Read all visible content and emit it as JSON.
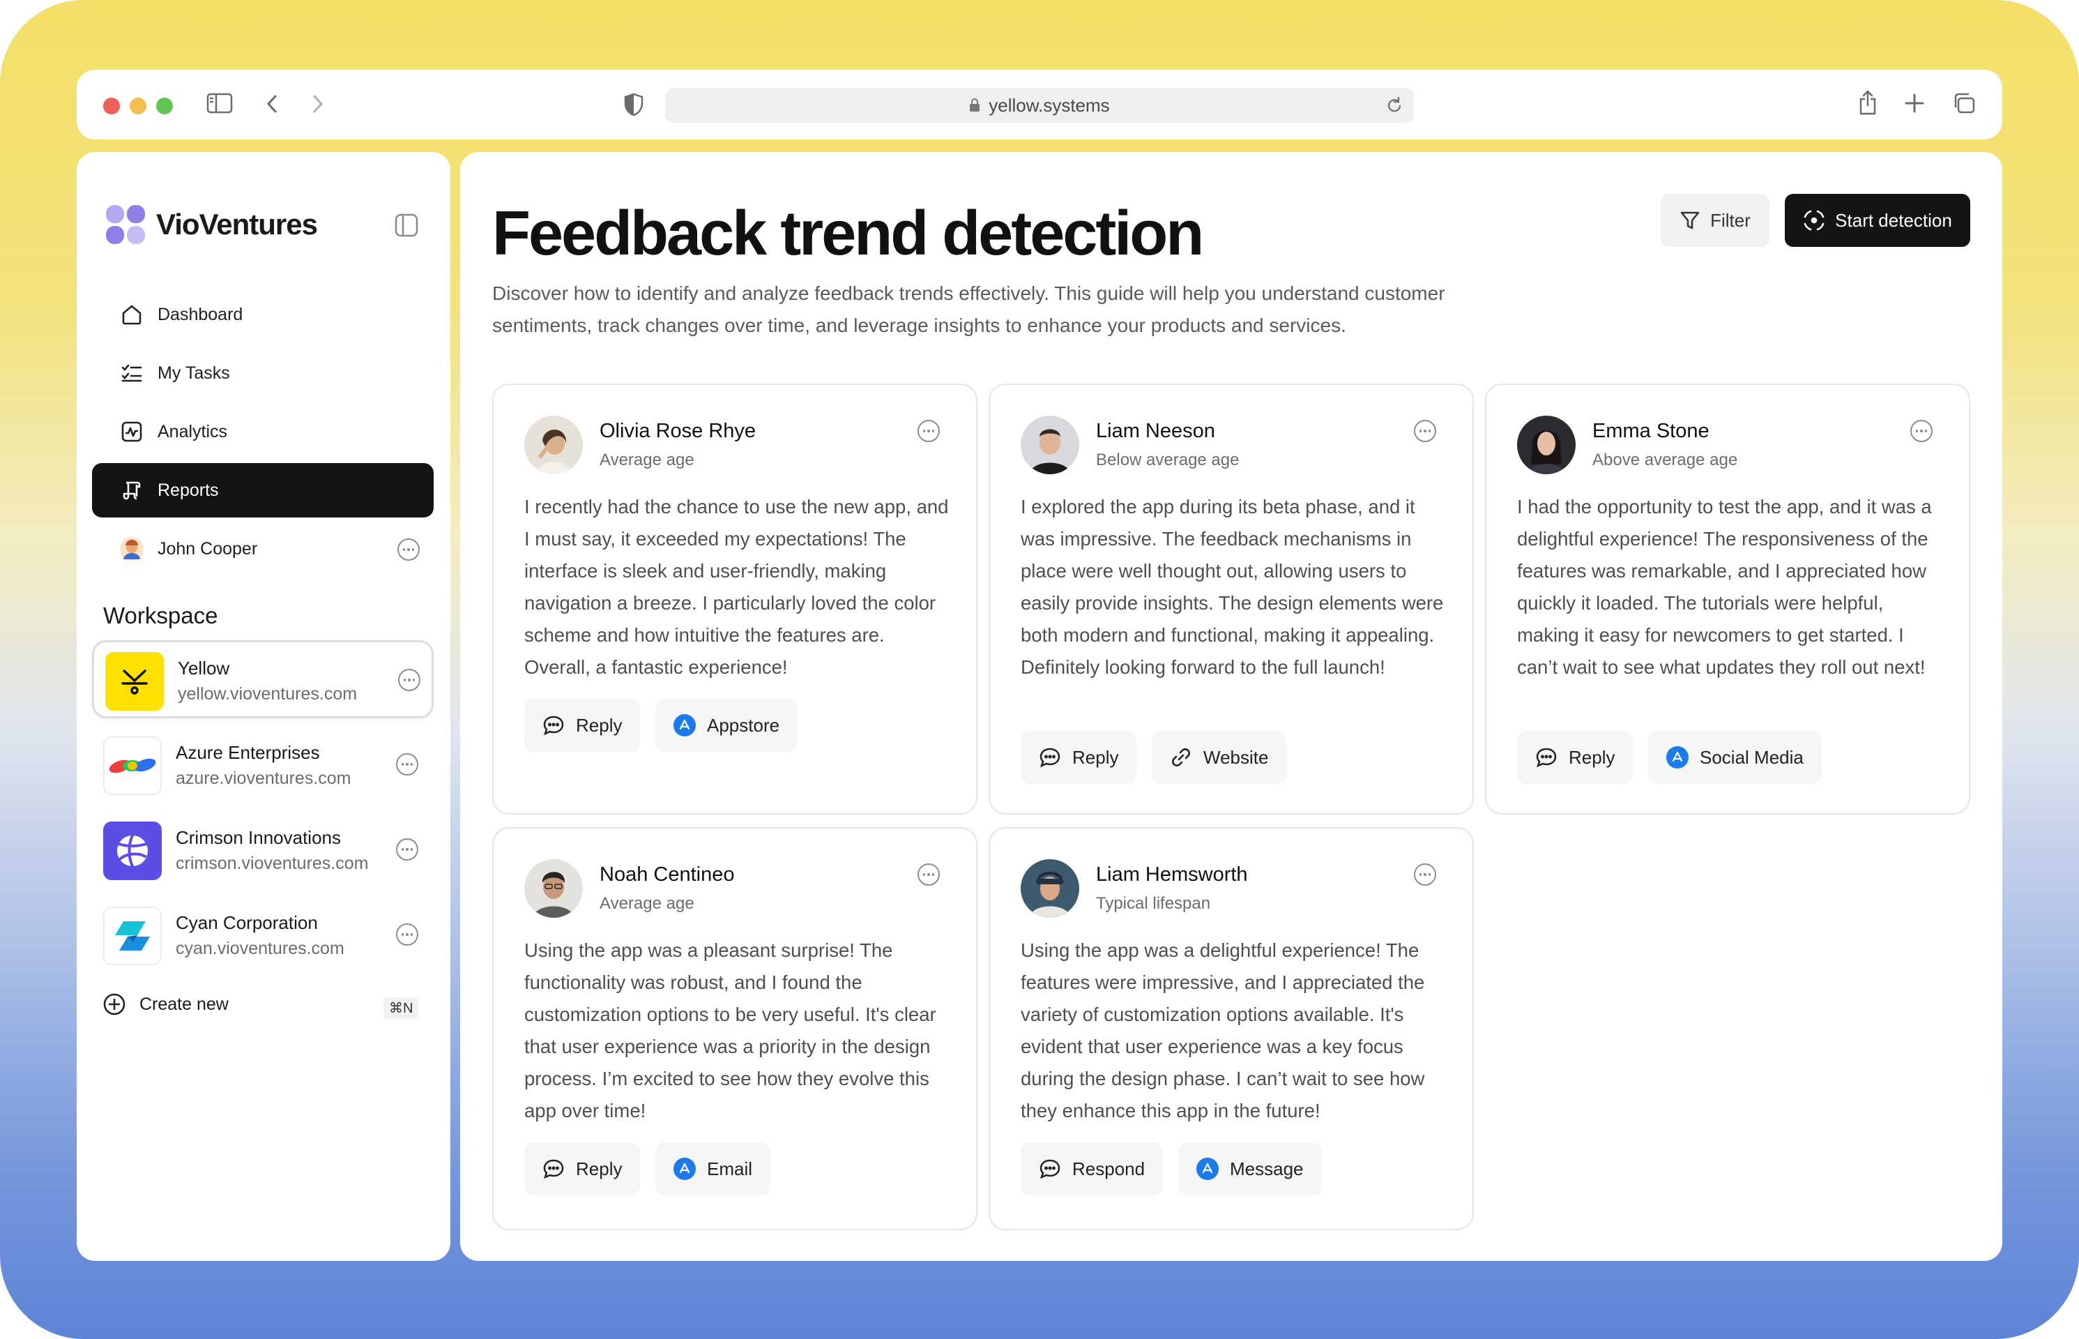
{
  "browser": {
    "url": "yellow.systems"
  },
  "sidebar": {
    "brand": "VioVentures",
    "nav": [
      {
        "label": "Dashboard",
        "icon": "home-icon"
      },
      {
        "label": "My Tasks",
        "icon": "tasks-icon"
      },
      {
        "label": "Analytics",
        "icon": "analytics-icon"
      },
      {
        "label": "Reports",
        "icon": "reports-icon",
        "active": true
      },
      {
        "label": "John Cooper",
        "icon": "avatar"
      }
    ],
    "workspace_title": "Workspace",
    "workspaces": [
      {
        "name": "Yellow",
        "url": "yellow.vioventures.com",
        "active": true
      },
      {
        "name": "Azure Enterprises",
        "url": "azure.vioventures.com"
      },
      {
        "name": "Crimson Innovations",
        "url": "crimson.vioventures.com"
      },
      {
        "name": "Cyan Corporation",
        "url": "cyan.vioventures.com"
      }
    ],
    "create_label": "Create new",
    "create_shortcut": "⌘N"
  },
  "main": {
    "title": "Feedback trend detection",
    "description": "Discover how to identify and analyze feedback trends effectively. This guide will help you understand customer sentiments, track changes over time, and leverage insights to enhance your products and services.",
    "filter_label": "Filter",
    "start_label": "Start detection",
    "cards": [
      {
        "name": "Olivia Rose Rhye",
        "subtitle": "Average age",
        "text": "I recently had the chance to use the new app, and I must say, it exceeded my expectations! The interface is sleek and user-friendly, making navigation a breeze. I particularly loved the color scheme and how intuitive the features are. Overall, a fantastic experience!",
        "action1": "Reply",
        "action2": "Appstore",
        "action2_icon": "appstore-icon"
      },
      {
        "name": "Liam Neeson",
        "subtitle": "Below average age",
        "text": "I explored the app during its beta phase, and it was impressive. The feedback mechanisms in place were well thought out, allowing users to easily provide insights. The design elements were both modern and functional, making it appealing. Definitely looking forward to the full launch!",
        "action1": "Reply",
        "action2": "Website",
        "action2_icon": "link-icon"
      },
      {
        "name": "Emma Stone",
        "subtitle": "Above average age",
        "text": "I had the opportunity to test the app, and it was a delightful experience! The responsiveness of the features was remarkable, and I appreciated how quickly it loaded. The tutorials were helpful, making it easy for newcomers to get started. I can’t wait to see what updates they roll out next!",
        "action1": "Reply",
        "action2": "Social Media",
        "action2_icon": "appstore-icon"
      },
      {
        "name": "Noah Centineo",
        "subtitle": "Average age",
        "text": "Using the app was a pleasant surprise! The functionality was robust, and I found the customization options to be very useful. It's clear that user experience was a priority in the design process. I’m excited to see how they evolve this app over time!",
        "action1": "Reply",
        "action2": "Email",
        "action2_icon": "appstore-icon"
      },
      {
        "name": "Liam Hemsworth",
        "subtitle": "Typical lifespan",
        "text": "Using the app was a delightful experience! The features were impressive, and I appreciated the variety of customization options available. It's evident that user experience was a key focus during the design phase. I can’t wait to see how they enhance this app in the future!",
        "action1": "Respond",
        "action2": "Message",
        "action2_icon": "appstore-icon"
      }
    ]
  }
}
